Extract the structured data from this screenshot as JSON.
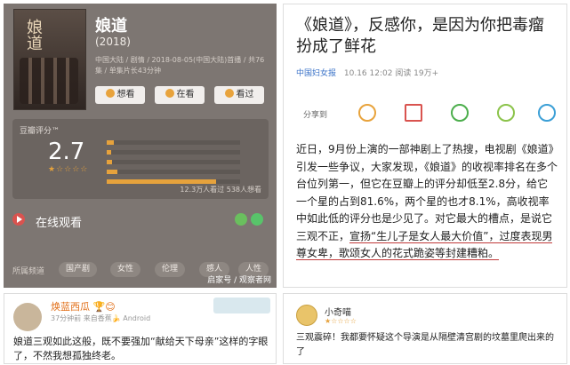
{
  "movie_card": {
    "poster_title": "娘道",
    "title": "娘道",
    "year": "(2018)",
    "meta": "中国大陆 / 剧情 / 2018-08-05(中国大陆)首播 / 共76集 / 单集片长43分钟",
    "buttons": [
      "想看",
      "在看",
      "看过"
    ],
    "rating_label": "豆瓣评分™",
    "score": "2.7",
    "stars": "★☆☆☆☆",
    "distribution": [
      0.05,
      0.03,
      0.04,
      0.08,
      0.82
    ],
    "counts": "12.3万人看过   538人想看",
    "watch_label": "在线观看",
    "tags_label": "所属频道",
    "tags": [
      "国产剧",
      "女性",
      "伦理",
      "感人",
      "人性"
    ],
    "watermark": "启家号 / 观察者网"
  },
  "article": {
    "title": "《娘道》，反感你，是因为你把毒瘤扮成了鲜花",
    "source": "中国妇女报",
    "time_reads": "10.16 12:02  阅读 19万+",
    "share_label": "分享到",
    "body_before": "近日，9月份上演的一部神剧上了热搜，电视剧《娘道》引发一些争议，大家发现，《娘道》的收视率排名在多个台位列第一，但它在豆瓣上的评分却低至2.8分，给它一个星的占到81.6%，两个星的也才8.1%，高收视率中如此低的评分也是少见了。对它最大的槽点，是说它三观不正，",
    "body_underlined": "宣扬“生儿子是女人最大价值”，过度表现男尊女卑，歌颂女人的花式跪姿等封建糟粕。"
  },
  "comment_left": {
    "user": "焕蓝西瓜 🏆😊",
    "meta": "37分钟前  来自香蕉🍌 Android",
    "text": "娘道三观如此这般，既不要强加“献给天下母亲”这样的字眼了，不然我想孤独终老。"
  },
  "comment_right": {
    "user": "小奇喵",
    "stars": "★☆☆☆☆",
    "text": "三观震碎！我都要怀疑这个导演是从隔壁清宫剧的坟墓里爬出来的了"
  },
  "colors": {
    "accent": "#e6a23c",
    "link": "#3b73c8",
    "underline": "#c03a3a"
  }
}
